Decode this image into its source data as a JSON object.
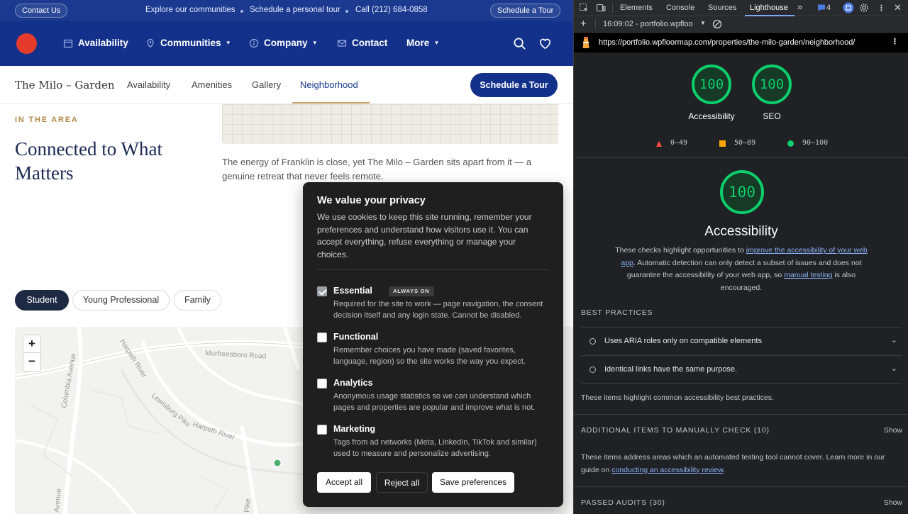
{
  "site": {
    "topbar": {
      "contact_us": "Contact Us",
      "explore": "Explore our communities",
      "schedule_personal": "Schedule a personal tour",
      "call": "Call (212) 684-0858",
      "schedule_tour": "Schedule a Tour"
    },
    "mainnav": {
      "availability": "Availability",
      "communities": "Communities",
      "company": "Company",
      "contact": "Contact",
      "more": "More"
    },
    "subnav": {
      "brand": "The Milo – Garden",
      "availability": "Availability",
      "amenities": "Amenities",
      "gallery": "Gallery",
      "neighborhood": "Neighborhood",
      "tour_button": "Schedule a Tour"
    },
    "section": {
      "eyebrow": "IN THE AREA",
      "headline": "Connected to What Matters",
      "intro": "The energy of Franklin is close, yet The Milo – Garden sits apart from it — a genuine retreat that never feels remote."
    },
    "chips": [
      "Student",
      "Young Professional",
      "Family"
    ],
    "map": {
      "zoom_in": "+",
      "zoom_out": "−",
      "roads": [
        "Murfreesboro Road",
        "Harpeth River",
        "Columbia Avenue",
        "Lewisburg Pike",
        "Harpeth River",
        "Avenue",
        "Pike"
      ]
    }
  },
  "cookie": {
    "title": "We value your privacy",
    "body": "We use cookies to keep this site running, remember your preferences and understand how visitors use it. You can accept everything, refuse everything or manage your choices.",
    "options": [
      {
        "title": "Essential",
        "badge": "ALWAYS ON",
        "checked": true,
        "desc": "Required for the site to work — page navigation, the consent decision itself and any login state. Cannot be disabled."
      },
      {
        "title": "Functional",
        "checked": false,
        "desc": "Remember choices you have made (saved favorites, language, region) so the site works the way you expect."
      },
      {
        "title": "Analytics",
        "checked": false,
        "desc": "Anonymous usage statistics so we can understand which pages and properties are popular and improve what is not."
      },
      {
        "title": "Marketing",
        "checked": false,
        "desc": "Tags from ad networks (Meta, LinkedIn, TikTok and similar) used to measure and personalize advertising."
      }
    ],
    "buttons": {
      "accept": "Accept all",
      "reject": "Reject all",
      "save": "Save preferences"
    }
  },
  "devtools": {
    "tabs": [
      "Elements",
      "Console",
      "Sources",
      "Lighthouse"
    ],
    "issues_count": "4",
    "report_selector": "16:09:02 - portfolio.wpfloo",
    "url": "https://portfolio.wpfloormap.com/properties/the-milo-garden/neighborhood/",
    "gauges": [
      {
        "label": "Accessibility",
        "score": "100"
      },
      {
        "label": "SEO",
        "score": "100"
      }
    ],
    "legend": [
      "0–49",
      "50–89",
      "90–100"
    ],
    "legend_colors": {
      "fail": "#ff4e42",
      "average": "#ffa400",
      "pass": "#0cce6b"
    },
    "main_score": "100",
    "main_title": "Accessibility",
    "desc": {
      "p1": "These checks highlight opportunities to ",
      "link1": "improve the accessibility of your web app",
      "p2": ". Automatic detection can only detect a subset of issues and does not guarantee the accessibility of your web app, so ",
      "link2": "manual testing",
      "p3": " is also encouraged."
    },
    "best_practices": {
      "heading": "BEST PRACTICES",
      "items": [
        "Uses ARIA roles only on compatible elements",
        "Identical links have the same purpose."
      ],
      "note": "These items highlight common accessibility best practices."
    },
    "manual": {
      "heading": "ADDITIONAL ITEMS TO MANUALLY CHECK (10)",
      "show": "Show",
      "note_prefix": "These items address areas which an automated testing tool cannot cover. Learn more in our guide on ",
      "note_link": "conducting an accessibility review",
      "note_suffix": "."
    },
    "passed": {
      "heading": "PASSED AUDITS (30)",
      "show": "Show"
    }
  }
}
